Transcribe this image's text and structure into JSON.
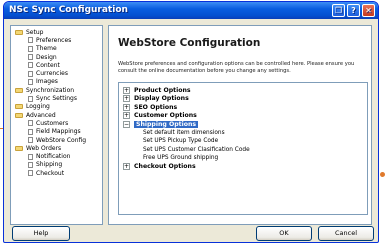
{
  "window": {
    "title": "NSc Sync Configuration"
  },
  "title_buttons": {
    "help": "?",
    "close": "✕"
  },
  "tree": {
    "items": [
      {
        "label": "Setup",
        "level": 1,
        "icon": "folder-icon"
      },
      {
        "label": "Preferences",
        "level": 2,
        "icon": "page-icon"
      },
      {
        "label": "Theme",
        "level": 2,
        "icon": "page-icon"
      },
      {
        "label": "Design",
        "level": 2,
        "icon": "page-icon"
      },
      {
        "label": "Content",
        "level": 2,
        "icon": "page-icon"
      },
      {
        "label": "Currencies",
        "level": 2,
        "icon": "page-icon"
      },
      {
        "label": "Images",
        "level": 2,
        "icon": "page-icon"
      },
      {
        "label": "Synchronization",
        "level": 1,
        "icon": "folder-icon"
      },
      {
        "label": "Sync Settings",
        "level": 2,
        "icon": "page-icon"
      },
      {
        "label": "Logging",
        "level": 1,
        "icon": "folder-icon"
      },
      {
        "label": "Advanced",
        "level": 1,
        "icon": "folder-icon"
      },
      {
        "label": "Customers",
        "level": 2,
        "icon": "page-icon"
      },
      {
        "label": "Field Mappings",
        "level": 2,
        "icon": "page-icon"
      },
      {
        "label": "WebStore Config",
        "level": 2,
        "icon": "page-icon"
      },
      {
        "label": "Web Orders",
        "level": 1,
        "icon": "folder-icon"
      },
      {
        "label": "Notification",
        "level": 2,
        "icon": "page-icon"
      },
      {
        "label": "Shipping",
        "level": 2,
        "icon": "page-icon"
      },
      {
        "label": "Checkout",
        "level": 2,
        "icon": "page-icon"
      }
    ]
  },
  "content": {
    "title": "WebStore Configuration",
    "description": "WebStore preferences and configuration options can be controlled here. Please ensure you consult the online documentation before you change any settings."
  },
  "options": {
    "product": {
      "label": "Product Options",
      "expander": "+"
    },
    "display": {
      "label": "Display Options",
      "expander": "+"
    },
    "seo": {
      "label": "SEO Options",
      "expander": "+"
    },
    "customer": {
      "label": "Customer Options",
      "expander": "+"
    },
    "shipping": {
      "label": "Shipping Options",
      "expander": "−",
      "children": [
        "Set default item dimensions",
        "Set UPS Pickup Type Code",
        "Set UPS Customer Clasification Code",
        "Free UPS Ground shipping"
      ]
    },
    "checkout": {
      "label": "Checkout Options",
      "expander": "+"
    }
  },
  "buttons": {
    "help": "Help",
    "ok": "OK",
    "cancel": "Cancel"
  },
  "colors": {
    "accent": "#e07a2c",
    "titlebar": "#0a5ee0",
    "selection": "#316ac5"
  }
}
